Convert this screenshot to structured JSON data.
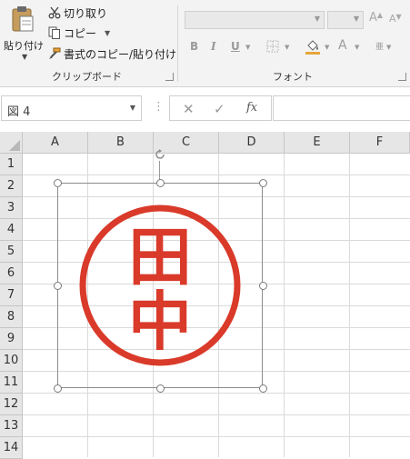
{
  "ribbon": {
    "clipboard": {
      "paste_label": "貼り付け",
      "cut_label": "切り取り",
      "copy_label": "コピー",
      "format_painter_label": "書式のコピー/貼り付け",
      "group_label": "クリップボード"
    },
    "font": {
      "group_label": "フォント",
      "bold": "B",
      "italic": "I",
      "underline": "U",
      "grow": "A",
      "shrink": "A",
      "font_color": "A",
      "phonetic": "亜"
    }
  },
  "formula_bar": {
    "name_box": "図 4",
    "fx": "fx",
    "formula": ""
  },
  "grid": {
    "columns": [
      "A",
      "B",
      "C",
      "D",
      "E",
      "F"
    ],
    "rows": [
      "1",
      "2",
      "3",
      "4",
      "5",
      "6",
      "7",
      "8",
      "9",
      "10",
      "11",
      "12",
      "13",
      "14"
    ]
  },
  "picture": {
    "stamp_text": "田中",
    "stamp_color": "#d93a2a"
  },
  "colors": {
    "accent_fill": "#e8a53a",
    "font_color_bar": "#e03c2c",
    "fill_color_bar": "#e8a53a"
  }
}
